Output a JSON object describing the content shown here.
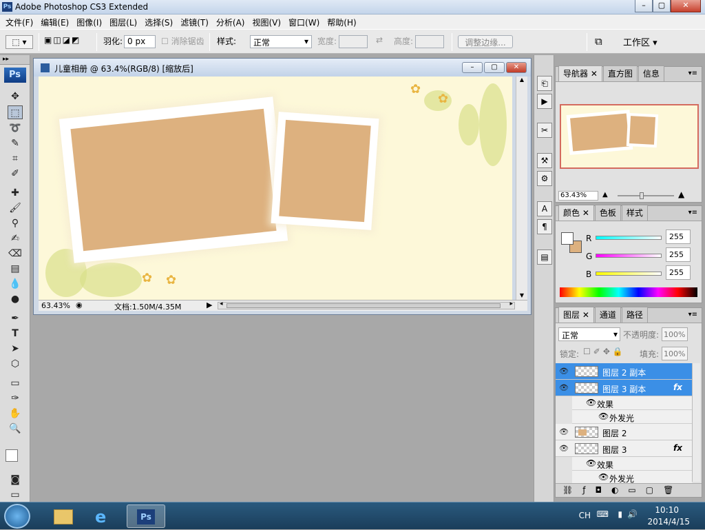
{
  "window": {
    "title": "Adobe Photoshop CS3 Extended",
    "icon": "Ps"
  },
  "menu": [
    "文件(F)",
    "编辑(E)",
    "图像(I)",
    "图层(L)",
    "选择(S)",
    "滤镜(T)",
    "分析(A)",
    "视图(V)",
    "窗口(W)",
    "帮助(H)"
  ],
  "options": {
    "feather_label": "羽化:",
    "feather_value": "0 px",
    "antialias_label": "消除锯齿",
    "style_label": "样式:",
    "style_value": "正常",
    "width_label": "宽度:",
    "height_label": "高度:",
    "refine_label": "调整边缘...",
    "workspace_label": "工作区"
  },
  "toolbox": {
    "logo": "Ps"
  },
  "document": {
    "title": "儿童相册 @ 63.4%(RGB/8) [缩放后]",
    "zoom": "63.43%",
    "doc_info": "文档:1.50M/4.35M"
  },
  "navigator": {
    "tabs": [
      "导航器",
      "直方图",
      "信息"
    ],
    "zoom": "63.43%"
  },
  "color": {
    "tabs": [
      "颜色",
      "色板",
      "样式"
    ],
    "r_label": "R",
    "g_label": "G",
    "b_label": "B",
    "r": "255",
    "g": "255",
    "b": "255"
  },
  "layers": {
    "tabs": [
      "图层",
      "通道",
      "路径"
    ],
    "blend": "正常",
    "opacity_label": "不透明度:",
    "opacity": "100%",
    "lock_label": "锁定:",
    "fill_label": "填充:",
    "fill": "100%",
    "items": [
      {
        "name": "图层 2 副本"
      },
      {
        "name": "图层 3 副本",
        "fx": "fx"
      },
      {
        "name": "图层 2"
      },
      {
        "name": "图层 3",
        "fx": "fx"
      }
    ],
    "effects_label": "效果",
    "outer_glow_label": "外发光"
  },
  "taskbar": {
    "lang": "CH",
    "time": "10:10",
    "date": "2014/4/15"
  },
  "colors": {
    "photo": "#ddb17f",
    "canvas": "#fdf8d9",
    "selection": "#3b8fe6"
  }
}
